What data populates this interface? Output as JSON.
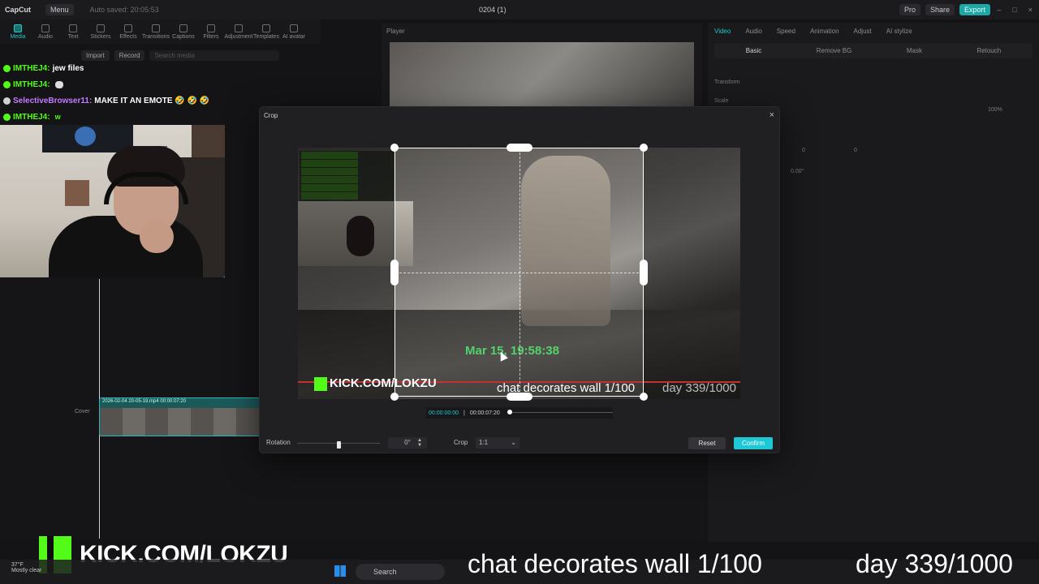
{
  "topbar": {
    "logo": "CapCut",
    "menu": "Menu",
    "autosave": "Auto saved: 20:05:53",
    "project_title": "0204 (1)",
    "pro": "Pro",
    "share": "Share",
    "export": "Export"
  },
  "toolbar": {
    "tabs": [
      "Media",
      "Audio",
      "Text",
      "Stickers",
      "Effects",
      "Transitions",
      "Captions",
      "Filters",
      "Adjustment",
      "Templates",
      "AI avatar"
    ]
  },
  "media": {
    "import": "Import",
    "record": "Record",
    "search_placeholder": "Search media"
  },
  "player": {
    "label": "Player"
  },
  "inspector": {
    "tabs": [
      "Video",
      "Audio",
      "Speed",
      "Animation",
      "Adjust",
      "AI stylize"
    ],
    "subtabs": [
      "Basic",
      "Remove BG",
      "Mask",
      "Retouch"
    ],
    "transform": "Transform",
    "scale": "Scale",
    "scale_value": "100%",
    "x": "0",
    "y": "0",
    "rotate": "0.00°"
  },
  "chat": [
    {
      "user": "IMTHEJ4:",
      "msg": "jew files",
      "style": "green"
    },
    {
      "user": "IMTHEJ4:",
      "msg": "",
      "style": "green"
    },
    {
      "user": "SelectiveBrowser11:",
      "msg": "MAKE IT AN EMOTE 🤣 🤣 🤣",
      "style": "purple"
    },
    {
      "user": "IMTHEJ4:",
      "msg": "",
      "style": "green"
    }
  ],
  "timeline": {
    "clip_label": "2026-02-04 20-05-19.mp4  00:00:07:20",
    "cover": "Cover"
  },
  "crop": {
    "title": "Crop",
    "close": "×",
    "timestamp_overlay": "Mar 15, 19:58:38",
    "kick_overlay": "KICK.COM/LOKZU",
    "sub_overlay": "chat decorates wall 1/100",
    "day_overlay": "day 339/1000",
    "current_time": "00:00:00:00",
    "total_time": "00:00:07:20",
    "rotation_label": "Rotation",
    "rotation_value": "0°",
    "rotation_level": 0.5,
    "crop_label": "Crop",
    "crop_ratio": "1:1",
    "reset": "Reset",
    "confirm": "Confirm"
  },
  "stream_overlay": {
    "kick_url": "KICK.COM/LOKZU",
    "caption": "chat decorates wall 1/100",
    "day": "day 339/1000"
  },
  "taskbar": {
    "weather": "37°F",
    "weather_sub": "Mostly clear",
    "search": "Search"
  }
}
